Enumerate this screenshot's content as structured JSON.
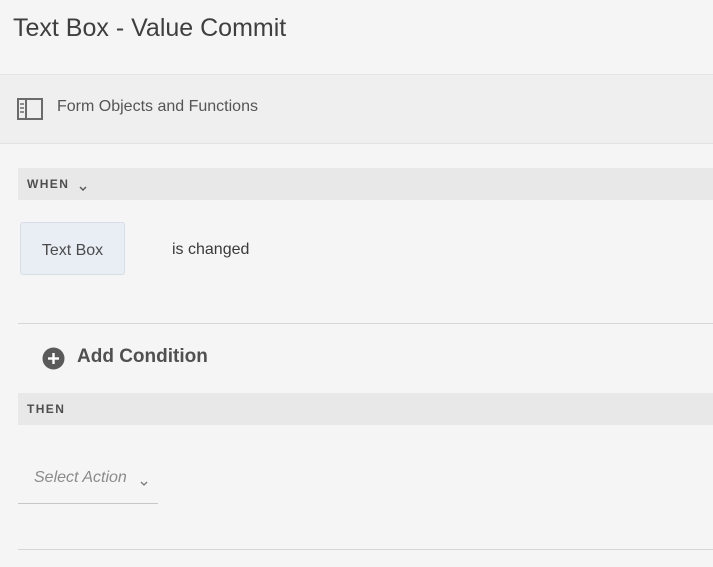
{
  "header": {
    "title": "Text Box - Value Commit"
  },
  "toolbar": {
    "icon": "side-panel-icon",
    "label": "Form Objects and Functions"
  },
  "when_section": {
    "label": "WHEN",
    "component": "Text Box",
    "event": "is changed"
  },
  "add_condition": {
    "label": "Add Condition",
    "icon": "plus-circle-icon"
  },
  "then_section": {
    "label": "THEN",
    "select_action": {
      "placeholder": "Select Action"
    }
  },
  "colors": {
    "background": "#f5f5f5",
    "section_header": "#e8e8e8",
    "chip_background": "#e9eef5",
    "text_primary": "#4b4b4b",
    "placeholder": "#8b8b8b"
  }
}
